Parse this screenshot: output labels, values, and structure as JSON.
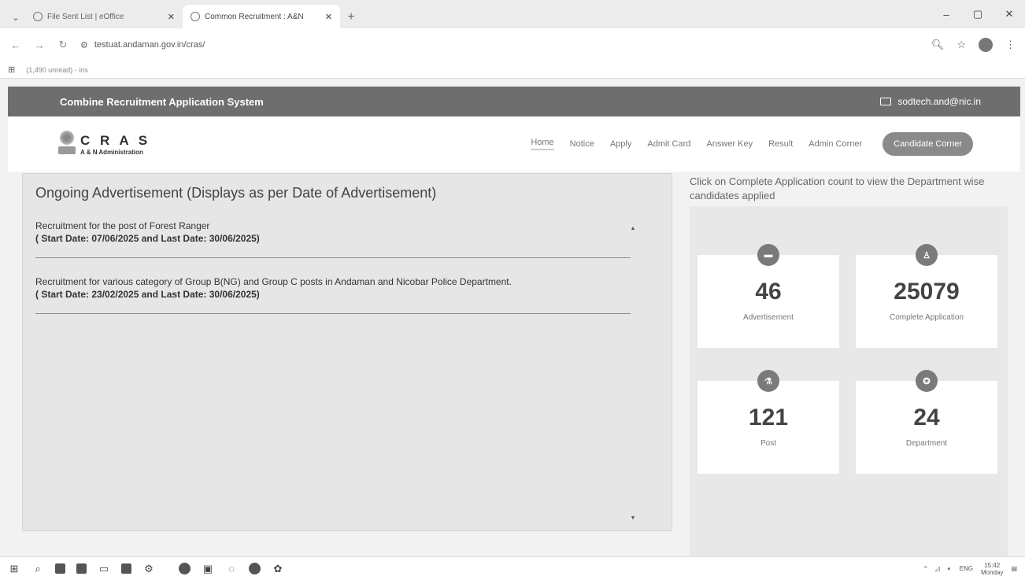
{
  "browser": {
    "tabs": [
      {
        "title": "File Sent List | eOffice",
        "active": false
      },
      {
        "title": "Common Recruitment : A&N",
        "active": true
      }
    ],
    "new_tab": "+",
    "url": "testuat.andaman.gov.in/cras/",
    "bookmark": "(1,490 unread) - ins",
    "window_controls": {
      "minimize": "–",
      "maximize": "▢",
      "close": "✕"
    }
  },
  "site": {
    "system_name": "Combine Recruitment Application System",
    "email": "sodtech.and@nic.in",
    "logo_title": "C R A S",
    "logo_subtitle": "A & N Administration",
    "nav": [
      "Home",
      "Notice",
      "Apply",
      "Admit Card",
      "Answer Key",
      "Result",
      "Admin Corner"
    ],
    "candidate_button": "Candidate Corner"
  },
  "ads": {
    "heading": "Ongoing Advertisement (Displays as per Date of Advertisement)",
    "items": [
      {
        "title": "Recruitment for the post of Forest Ranger",
        "dates": "( Start Date: 07/06/2025 and Last Date: 30/06/2025)"
      },
      {
        "title": "Recruitment for various category of Group B(NG) and Group C posts in Andaman and Nicobar Police Department.",
        "dates": "( Start Date: 23/02/2025 and Last Date: 30/06/2025)"
      }
    ]
  },
  "stats": {
    "intro": "Click on Complete Application count to view the Department wise candidates applied",
    "cards": [
      {
        "value": "46",
        "label": "Advertisement",
        "icon": "briefcase-icon"
      },
      {
        "value": "25079",
        "label": "Complete Application",
        "icon": "user-icon"
      },
      {
        "value": "121",
        "label": "Post",
        "icon": "flask-icon"
      },
      {
        "value": "24",
        "label": "Department",
        "icon": "award-icon"
      }
    ]
  },
  "taskbar": {
    "lang": "ENG",
    "time": "15:42",
    "day": "Monday"
  }
}
